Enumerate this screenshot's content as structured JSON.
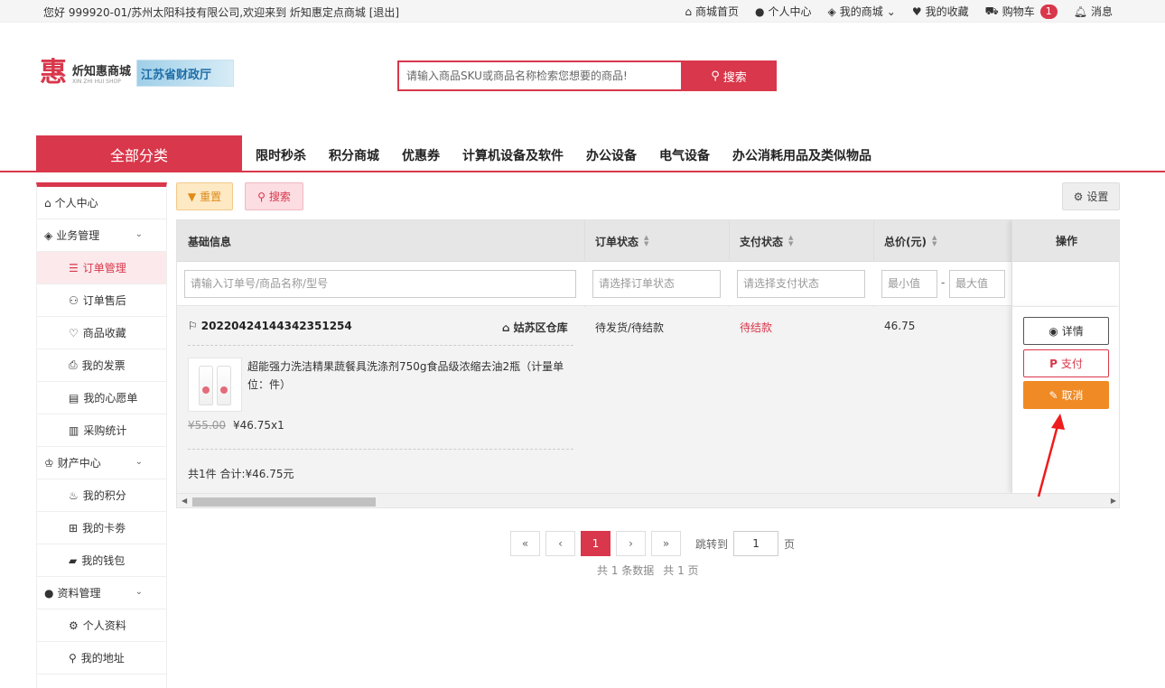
{
  "topbar": {
    "welcome": "您好 999920-01/苏州太阳科技有限公司,欢迎来到 炘知惠定点商城 [退出]",
    "links": [
      "商城首页",
      "个人中心",
      "我的商城",
      "我的收藏",
      "购物车",
      "消息"
    ],
    "cart_count": "1"
  },
  "logo": {
    "char": "惠",
    "name": "炘知惠商城",
    "sub": "XIN ZHI HUI SHOP",
    "gov": "江苏省财政厅"
  },
  "search": {
    "placeholder": "请输入商品SKU或商品名称检索您想要的商品!",
    "button": "搜索"
  },
  "nav": {
    "all": "全部分类",
    "items": [
      "限时秒杀",
      "积分商城",
      "优惠券",
      "计算机设备及软件",
      "办公设备",
      "电气设备",
      "办公消耗用品及类似物品"
    ]
  },
  "sidebar": {
    "personal_center": "个人中心",
    "business": "业务管理",
    "order_mgmt": "订单管理",
    "after_sale": "订单售后",
    "favorites": "商品收藏",
    "invoice": "我的发票",
    "wishlist": "我的心愿单",
    "purchase_stats": "采购统计",
    "assets": "财产中心",
    "points": "我的积分",
    "coupons": "我的卡劵",
    "wallet": "我的钱包",
    "profile_mgmt": "资料管理",
    "profile": "个人资料",
    "address": "我的地址"
  },
  "toolbar": {
    "reset": "重置",
    "search": "搜索",
    "settings": "设置"
  },
  "table": {
    "headers": {
      "basic": "基础信息",
      "order_status": "订单状态",
      "pay_status": "支付状态",
      "total": "总价(元)",
      "ops": "操作"
    },
    "filters": {
      "basic": "请输入订单号/商品名称/型号",
      "order_status": "请选择订单状态",
      "pay_status": "请选择支付状态",
      "min": "最小值",
      "max": "最大值",
      "sep": "-"
    },
    "row": {
      "order_no": "20220424144342351254",
      "warehouse": "姑苏区仓库",
      "product_name": "超能强力洗洁精果蔬餐具洗涤剂750g食品级浓缩去油2瓶（计量单位：件）",
      "old_price": "¥55.00",
      "price": "¥46.75x1",
      "summary": "共1件 合计:¥46.75元",
      "order_status": "待发货/待结款",
      "pay_status": "待结款",
      "total": "46.75",
      "btn_detail": "详情",
      "btn_pay": "支付",
      "btn_cancel": "取消"
    }
  },
  "pager": {
    "first": "«",
    "prev": "‹",
    "current": "1",
    "next": "›",
    "last": "»",
    "jump_label": "跳转到",
    "jump_value": "1",
    "page_unit": "页",
    "total_records": "共 1 条数据",
    "total_pages": "共 1 页"
  },
  "colors": {
    "brand": "#d9374b",
    "cancel": "#f08a24"
  }
}
